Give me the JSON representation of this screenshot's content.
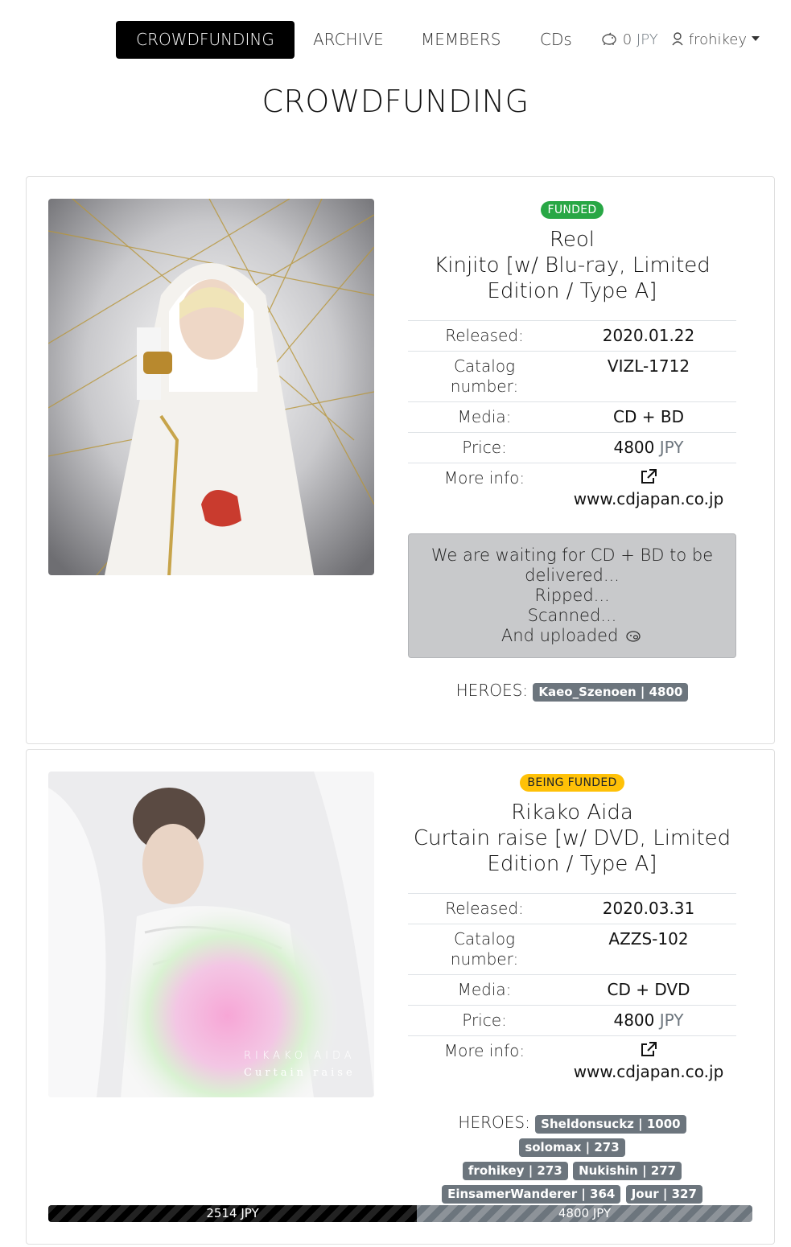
{
  "nav": {
    "items": [
      {
        "label": "CROWDFUNDING",
        "active": true
      },
      {
        "label": "ARCHIVE",
        "active": false
      },
      {
        "label": "MEMBERS",
        "active": false
      },
      {
        "label": "CDs",
        "active": false
      }
    ],
    "wallet_amount": "0",
    "wallet_currency": "JPY",
    "wallet_icon": "piggy-bank-icon",
    "username": "frohikey",
    "user_icon": "user-icon"
  },
  "page_title": "CROWDFUNDING",
  "labels": {
    "released": "Released:",
    "catalog": "Catalog number:",
    "media": "Media:",
    "price": "Price:",
    "more_info": "More info:",
    "heroes": "HEROES:",
    "currency": "JPY"
  },
  "campaigns": [
    {
      "status": "FUNDED",
      "artist": "Reol",
      "album": "Kinjito [w/ Blu-ray, Limited Edition / Type A]",
      "released": "2020.01.22",
      "catalog_number": "VIZL-1712",
      "media": "CD + BD",
      "price": "4800",
      "more_info_link": "www.cdjapan.co.jp",
      "waiting_lines": [
        "We are waiting for CD + BD to be delivered...",
        "Ripped...",
        "Scanned...",
        "And uploaded"
      ],
      "heroes": [
        "Kaeo_Szenoen | 4800"
      ]
    },
    {
      "status": "BEING FUNDED",
      "artist": "Rikako Aida",
      "album": "Curtain raise [w/ DVD, Limited Edition / Type A]",
      "released": "2020.03.31",
      "catalog_number": "AZZS-102",
      "media": "CD + DVD",
      "price": "4800",
      "more_info_link": "www.cdjapan.co.jp",
      "cover_text": {
        "line1": "RIKAKO AIDA",
        "line2": "Curtain raise"
      },
      "heroes": [
        "Sheldonsuckz | 1000",
        "solomax | 273",
        "frohikey | 273",
        "Nukishin | 277",
        "EinsamerWanderer | 364",
        "Jour | 327"
      ],
      "progress": {
        "raised": 2514,
        "goal": 4800,
        "raised_label": "2514 JPY",
        "goal_label": "4800 JPY"
      }
    }
  ]
}
